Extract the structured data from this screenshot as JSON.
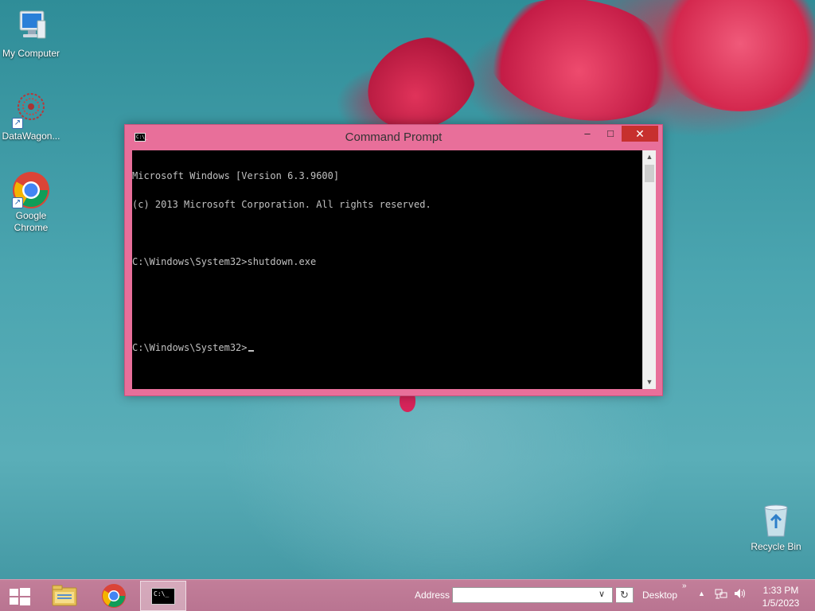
{
  "desktop": {
    "icons": [
      {
        "label": "My Computer"
      },
      {
        "label": "DataWagon..."
      },
      {
        "label": "Google Chrome"
      },
      {
        "label": "Recycle Bin"
      }
    ]
  },
  "window": {
    "title": "Command Prompt",
    "title_icon_text": "C:\\_",
    "minimize": "–",
    "maximize": "□",
    "close": "✕",
    "console_lines": [
      "Microsoft Windows [Version 6.3.9600]",
      "(c) 2013 Microsoft Corporation. All rights reserved.",
      "",
      "C:\\Windows\\System32>shutdown.exe",
      "",
      "",
      "C:\\Windows\\System32>"
    ],
    "scroll_up": "▲",
    "scroll_down": "▼"
  },
  "taskbar": {
    "address_label": "Address",
    "address_value": "",
    "address_dropdown": "∨",
    "refresh": "↻",
    "desktop_label": "Desktop",
    "overflow": "»",
    "tray_up": "▲",
    "network_icon": "🖧",
    "volume_icon": "🔈",
    "time": "1:33 PM",
    "date": "1/5/2023",
    "cmd_icon_text": "C:\\_"
  },
  "colors": {
    "window_frame": "#e86f9a",
    "close_button": "#c7302e",
    "console_bg": "#000000",
    "console_text": "#c0c0c0",
    "taskbar": "#bf7b97"
  }
}
